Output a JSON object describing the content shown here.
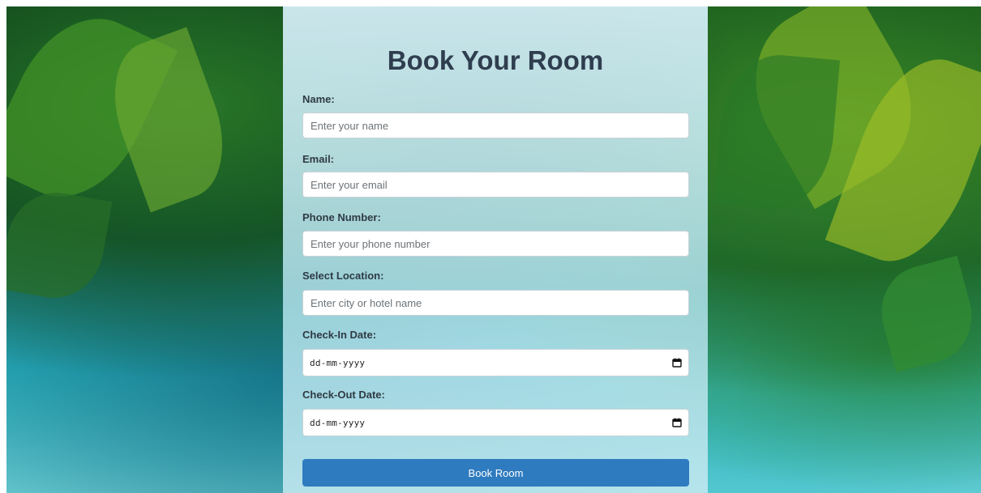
{
  "form": {
    "title": "Book Your Room",
    "name": {
      "label": "Name:",
      "placeholder": "Enter your name"
    },
    "email": {
      "label": "Email:",
      "placeholder": "Enter your email"
    },
    "phone": {
      "label": "Phone Number:",
      "placeholder": "Enter your phone number"
    },
    "location": {
      "label": "Select Location:",
      "placeholder": "Enter city or hotel name"
    },
    "checkin": {
      "label": "Check-In Date:",
      "value": "dd-mm-yyyy",
      "icon": "calendar-icon"
    },
    "checkout": {
      "label": "Check-Out Date:",
      "value": "dd-mm-yyyy",
      "icon": "calendar-icon"
    },
    "submit_label": "Book Room"
  },
  "colors": {
    "accent": "#2f7bbf",
    "title": "#2f3e4f"
  }
}
